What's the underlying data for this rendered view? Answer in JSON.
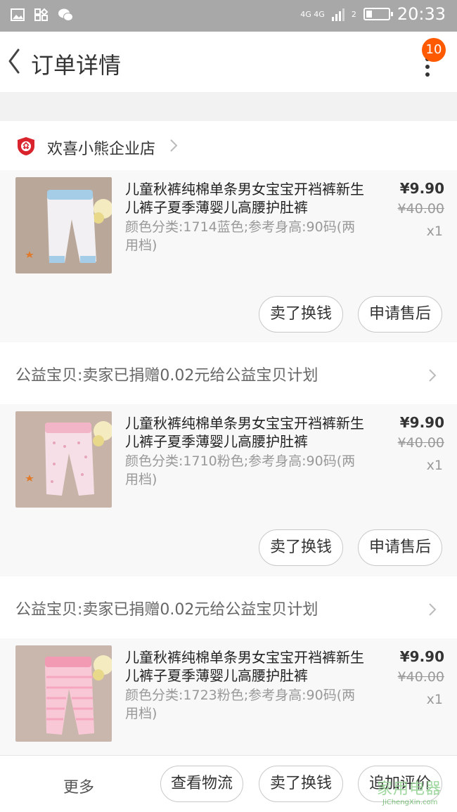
{
  "status_bar": {
    "network": "4G 4G",
    "sim": "2",
    "time": "20:33"
  },
  "header": {
    "title": "订单详情",
    "badge_count": "10"
  },
  "shop": {
    "name": "欢喜小熊企业店"
  },
  "products": [
    {
      "title": "儿童秋裤纯棉单条男女宝宝开裆裤新生儿裤子夏季薄婴儿高腰护肚裤",
      "sku": "颜色分类:1714蓝色;参考身高:90码(两用档)",
      "price": "¥9.90",
      "original_price": "¥40.00",
      "qty": "x1",
      "image_color": "blue-trim"
    },
    {
      "title": "儿童秋裤纯棉单条男女宝宝开裆裤新生儿裤子夏季薄婴儿高腰护肚裤",
      "sku": "颜色分类:1710粉色;参考身高:90码(两用档)",
      "price": "¥9.90",
      "original_price": "¥40.00",
      "qty": "x1",
      "image_color": "pink-dots"
    },
    {
      "title": "儿童秋裤纯棉单条男女宝宝开裆裤新生儿裤子夏季薄婴儿高腰护肚裤",
      "sku": "颜色分类:1723粉色;参考身高:90码(两用档)",
      "price": "¥9.90",
      "original_price": "¥40.00",
      "qty": "x1",
      "image_color": "pink-stripes"
    }
  ],
  "item_actions": {
    "sell": "卖了换钱",
    "after_sale": "申请售后"
  },
  "charity": {
    "text": "公益宝贝:卖家已捐赠0.02元给公益宝贝计划"
  },
  "bottom_bar": {
    "more": "更多",
    "logistics": "查看物流",
    "sell": "卖了换钱",
    "review": "追加评价"
  },
  "watermark": {
    "main": "家用电器",
    "sub": "JiChengXin.com"
  },
  "colors": {
    "accent": "#ff5a00",
    "status_bar": "#a8a8a8",
    "shop_icon": "#d9232d"
  }
}
